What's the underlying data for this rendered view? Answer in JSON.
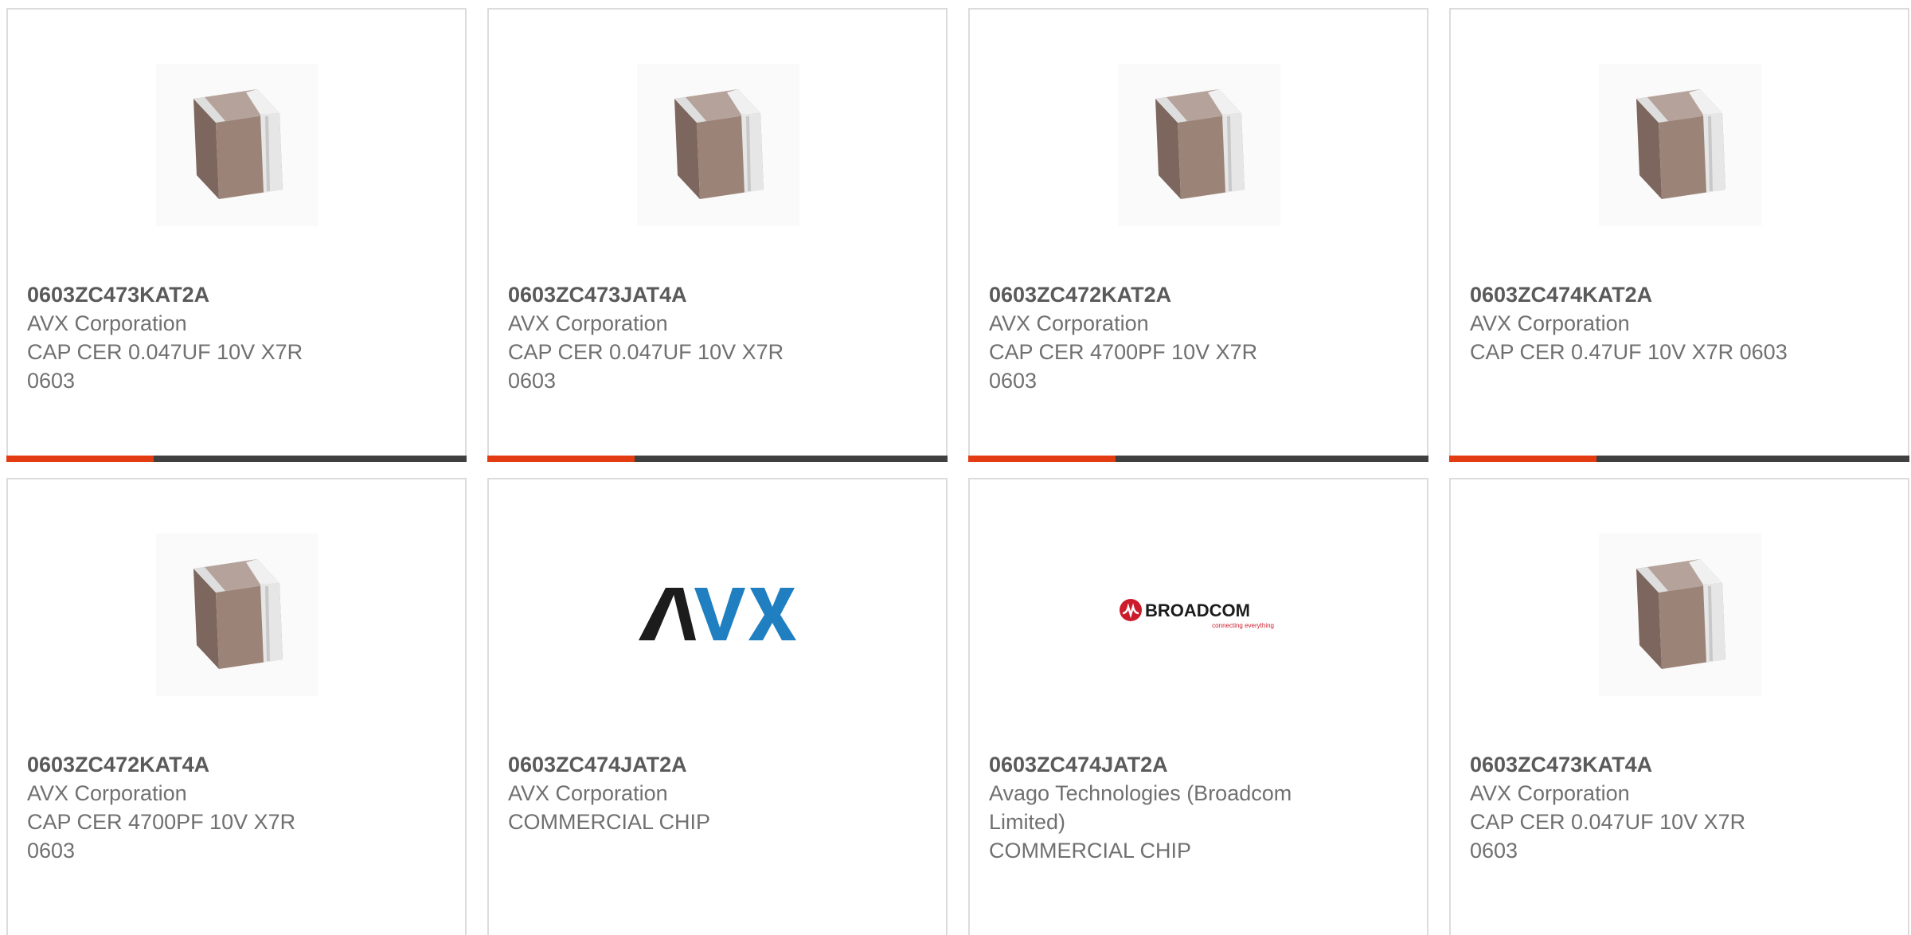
{
  "colors": {
    "progress_fill": "#e33b12",
    "progress_track": "#404040",
    "card_border": "#dcdcdc",
    "text_secondary": "#707070",
    "text_primary": "#5a5a5a",
    "avx_dark": "#1c1c1c",
    "avx_blue": "#1f7fc1",
    "broadcom_red": "#cc1c2c"
  },
  "cards": [
    {
      "part_number": "0603ZC473KAT2A",
      "manufacturer": "AVX Corporation",
      "description": "CAP CER 0.047UF 10V X7R 0603",
      "image": "ceramic-capacitor-image",
      "progress": 0.32
    },
    {
      "part_number": "0603ZC473JAT4A",
      "manufacturer": "AVX Corporation",
      "description": "CAP CER 0.047UF 10V X7R 0603",
      "image": "ceramic-capacitor-image",
      "progress": 0.32
    },
    {
      "part_number": "0603ZC472KAT2A",
      "manufacturer": "AVX Corporation",
      "description": "CAP CER 4700PF 10V X7R 0603",
      "image": "ceramic-capacitor-image",
      "progress": 0.32
    },
    {
      "part_number": "0603ZC474KAT2A",
      "manufacturer": "AVX Corporation",
      "description": "CAP CER 0.47UF 10V X7R 0603",
      "image": "ceramic-capacitor-image",
      "progress": 0.32
    },
    {
      "part_number": "0603ZC472KAT4A",
      "manufacturer": "AVX Corporation",
      "description": "CAP CER 4700PF 10V X7R 0603",
      "image": "ceramic-capacitor-image"
    },
    {
      "part_number": "0603ZC474JAT2A",
      "manufacturer": "AVX Corporation",
      "description": "COMMERCIAL CHIP",
      "image": "avx-logo",
      "logo_text": "AVX"
    },
    {
      "part_number": "0603ZC474JAT2A",
      "manufacturer": "Avago Technologies (Broadcom Limited)",
      "description": "COMMERCIAL CHIP",
      "image": "broadcom-logo",
      "logo_text": "BROADCOM",
      "logo_tagline": "connecting everything"
    },
    {
      "part_number": "0603ZC473KAT4A",
      "manufacturer": "AVX Corporation",
      "description": "CAP CER 0.047UF 10V X7R 0603",
      "image": "ceramic-capacitor-image"
    }
  ]
}
